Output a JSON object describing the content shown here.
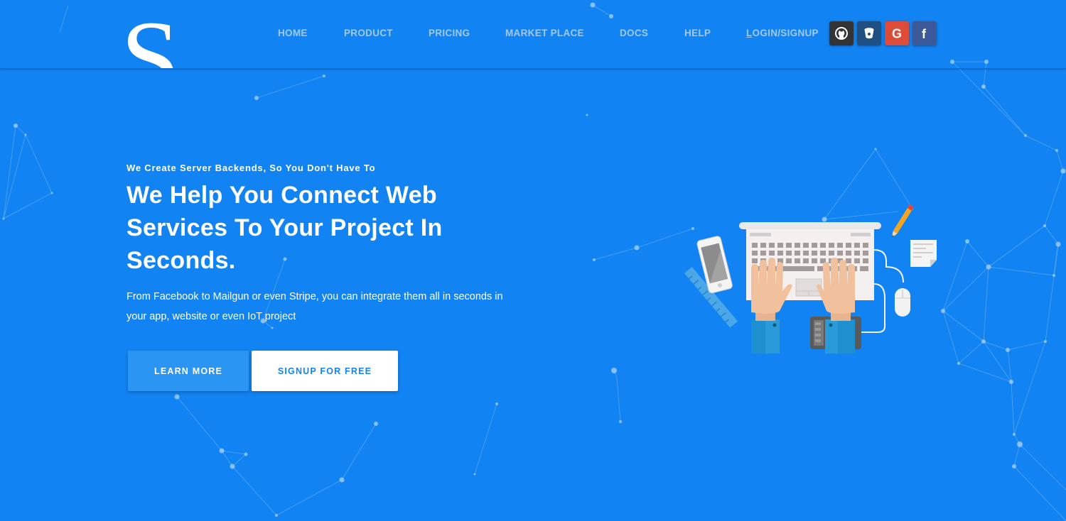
{
  "brand": {
    "logo_letter": "S"
  },
  "nav": {
    "items": [
      {
        "label": "HOME"
      },
      {
        "label": "PRODUCT"
      },
      {
        "label": "PRICING"
      },
      {
        "label": "MARKET PLACE"
      },
      {
        "label": "DOCS"
      },
      {
        "label": "HELP"
      }
    ],
    "login_first": "L",
    "login_rest": "OGIN/SIGNUP"
  },
  "social": [
    {
      "icon": "github-icon",
      "color": "#333333"
    },
    {
      "icon": "bitbucket-icon",
      "color": "#205081"
    },
    {
      "icon": "google-icon",
      "color": "#dd4b39"
    },
    {
      "icon": "facebook-icon",
      "color": "#3b5998"
    }
  ],
  "hero": {
    "eyebrow": "We Create Server Backends, So You Don't Have To",
    "headline": "We Help You Connect Web Services To Your Project In Seconds.",
    "description": "From Facebook to Mailgun or even Stripe, you can integrate them all in seconds in your app, website or even IoT project",
    "learn_more": "LEARN MORE",
    "signup": "SIGNUP FOR FREE"
  },
  "colors": {
    "background": "#1283f2",
    "nav_text": "#9fcaf7",
    "button_primary": "#2a95f3",
    "button_secondary": "#ffffff"
  }
}
